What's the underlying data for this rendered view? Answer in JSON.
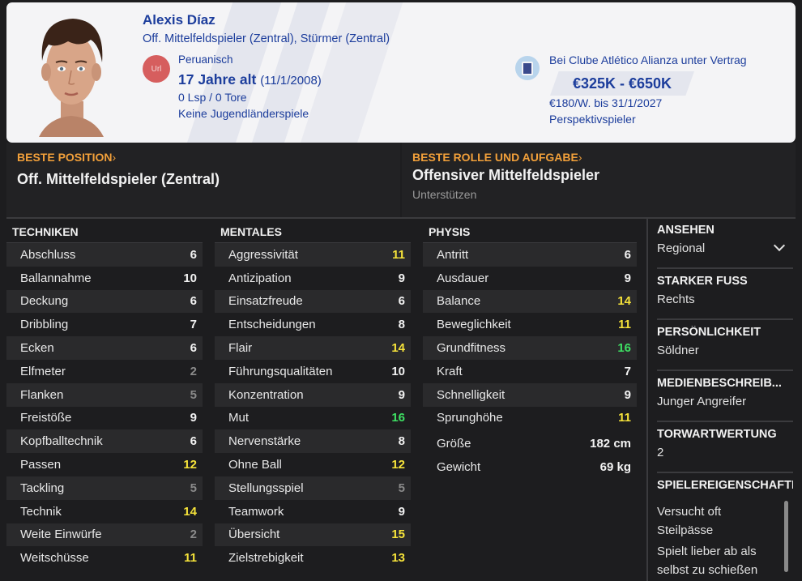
{
  "player": {
    "name": "Alexis Díaz",
    "positions": "Off. Mittelfeldspieler (Zentral), Stürmer (Zentral)",
    "nationality_flag": "Url",
    "nationality": "Peruanisch",
    "age": "17 Jahre alt",
    "dob": "(11/1/2008)",
    "caps": "0 Lsp / 0 Tore",
    "youth_caps": "Keine Jugendländerspiele",
    "contract_club": "Bei Clube Atlético Alianza unter Vertrag",
    "value_range": "€325K - €650K",
    "wage": "€180/W. bis 31/1/2027",
    "status": "Perspektivspieler"
  },
  "best_position": {
    "label": "BESTE POSITION",
    "arrow": "›",
    "value": "Off. Mittelfeldspieler (Zentral)"
  },
  "best_role": {
    "label": "BESTE ROLLE UND AUFGABE",
    "arrow": "›",
    "value": "Offensiver Mittelfeldspieler",
    "duty": "Unterstützen"
  },
  "attributes": {
    "technical": {
      "title": "TECHNIKEN",
      "items": [
        {
          "name": "Abschluss",
          "value": "6",
          "tier": "white"
        },
        {
          "name": "Ballannahme",
          "value": "10",
          "tier": "white"
        },
        {
          "name": "Deckung",
          "value": "6",
          "tier": "white"
        },
        {
          "name": "Dribbling",
          "value": "7",
          "tier": "white"
        },
        {
          "name": "Ecken",
          "value": "6",
          "tier": "white"
        },
        {
          "name": "Elfmeter",
          "value": "2",
          "tier": "grey"
        },
        {
          "name": "Flanken",
          "value": "5",
          "tier": "grey"
        },
        {
          "name": "Freistöße",
          "value": "9",
          "tier": "white"
        },
        {
          "name": "Kopfballtechnik",
          "value": "6",
          "tier": "white"
        },
        {
          "name": "Passen",
          "value": "12",
          "tier": "yellow"
        },
        {
          "name": "Tackling",
          "value": "5",
          "tier": "grey"
        },
        {
          "name": "Technik",
          "value": "14",
          "tier": "yellow"
        },
        {
          "name": "Weite Einwürfe",
          "value": "2",
          "tier": "grey"
        },
        {
          "name": "Weitschüsse",
          "value": "11",
          "tier": "yellow"
        }
      ]
    },
    "mental": {
      "title": "MENTALES",
      "items": [
        {
          "name": "Aggressivität",
          "value": "11",
          "tier": "yellow"
        },
        {
          "name": "Antizipation",
          "value": "9",
          "tier": "white"
        },
        {
          "name": "Einsatzfreude",
          "value": "6",
          "tier": "white"
        },
        {
          "name": "Entscheidungen",
          "value": "8",
          "tier": "white"
        },
        {
          "name": "Flair",
          "value": "14",
          "tier": "yellow"
        },
        {
          "name": "Führungsqualitäten",
          "value": "10",
          "tier": "white"
        },
        {
          "name": "Konzentration",
          "value": "9",
          "tier": "white"
        },
        {
          "name": "Mut",
          "value": "16",
          "tier": "green"
        },
        {
          "name": "Nervenstärke",
          "value": "8",
          "tier": "white"
        },
        {
          "name": "Ohne Ball",
          "value": "12",
          "tier": "yellow"
        },
        {
          "name": "Stellungsspiel",
          "value": "5",
          "tier": "grey"
        },
        {
          "name": "Teamwork",
          "value": "9",
          "tier": "white"
        },
        {
          "name": "Übersicht",
          "value": "15",
          "tier": "yellow"
        },
        {
          "name": "Zielstrebigkeit",
          "value": "13",
          "tier": "yellow"
        }
      ]
    },
    "physical": {
      "title": "PHYSIS",
      "items": [
        {
          "name": "Antritt",
          "value": "6",
          "tier": "white"
        },
        {
          "name": "Ausdauer",
          "value": "9",
          "tier": "white"
        },
        {
          "name": "Balance",
          "value": "14",
          "tier": "yellow"
        },
        {
          "name": "Beweglichkeit",
          "value": "11",
          "tier": "yellow"
        },
        {
          "name": "Grundfitness",
          "value": "16",
          "tier": "green"
        },
        {
          "name": "Kraft",
          "value": "7",
          "tier": "white"
        },
        {
          "name": "Schnelligkeit",
          "value": "9",
          "tier": "white"
        },
        {
          "name": "Sprunghöhe",
          "value": "11",
          "tier": "yellow"
        }
      ],
      "extra": [
        {
          "name": "Größe",
          "value": "182 cm"
        },
        {
          "name": "Gewicht",
          "value": "69 kg"
        }
      ]
    }
  },
  "sidebar": {
    "reputation": {
      "title": "ANSEHEN",
      "value": "Regional"
    },
    "foot": {
      "title": "STARKER FUSS",
      "value": "Rechts"
    },
    "personality": {
      "title": "PERSÖNLICHKEIT",
      "value": "Söldner"
    },
    "media": {
      "title": "MEDIENBESCHREIB...",
      "value": "Junger Angreifer"
    },
    "gk_rating": {
      "title": "TORWARTWERTUNG",
      "value": "2"
    },
    "traits": {
      "title": "SPIELEREIGENSCHAFTEN",
      "items": [
        "Versucht oft Steilpässe",
        "Spielt lieber ab als selbst zu schießen"
      ]
    }
  },
  "colors": {
    "accent_orange": "#f2a03a",
    "header_blue": "#1c3d9c",
    "tier_yellow": "#f6e33a",
    "tier_green": "#3ee063",
    "tier_grey": "#8a8a8a"
  }
}
